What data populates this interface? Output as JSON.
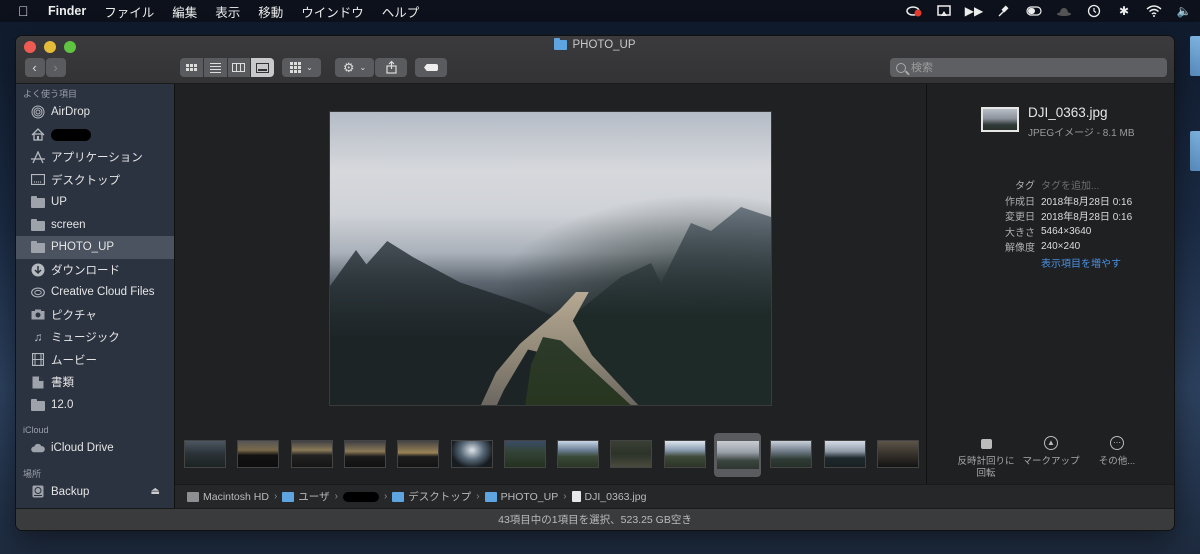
{
  "menubar": {
    "app_name": "Finder",
    "items": [
      "ファイル",
      "編集",
      "表示",
      "移動",
      "ウインドウ",
      "ヘルプ"
    ],
    "tray_icons": [
      "creative-cloud-icon",
      "airplay-icon",
      "fast-forward-icon",
      "pin-icon",
      "toggle-icon",
      "hat-icon",
      "time-machine-icon",
      "bluetooth-icon",
      "wifi-icon",
      "volume-icon"
    ]
  },
  "window": {
    "title": "PHOTO_UP"
  },
  "toolbar": {
    "back_label": "‹",
    "forward_label": "›",
    "view_modes": [
      "icon",
      "list",
      "column",
      "gallery"
    ],
    "active_view": "gallery",
    "search_placeholder": "検索"
  },
  "sidebar": {
    "sections": [
      {
        "header": "よく使う項目",
        "items": [
          {
            "label": "AirDrop",
            "icon": "airdrop-icon"
          },
          {
            "label": "",
            "icon": "home-icon",
            "redacted": true
          },
          {
            "label": "アプリケーション",
            "icon": "applications-icon"
          },
          {
            "label": "デスクトップ",
            "icon": "desktop-icon"
          },
          {
            "label": "UP",
            "icon": "folder-icon"
          },
          {
            "label": "screen",
            "icon": "folder-icon"
          },
          {
            "label": "PHOTO_UP",
            "icon": "folder-icon",
            "selected": true
          },
          {
            "label": "ダウンロード",
            "icon": "download-icon"
          },
          {
            "label": "Creative Cloud Files",
            "icon": "creative-cloud-icon"
          },
          {
            "label": "ピクチャ",
            "icon": "camera-icon"
          },
          {
            "label": "ミュージック",
            "icon": "music-icon"
          },
          {
            "label": "ムービー",
            "icon": "film-icon"
          },
          {
            "label": "書類",
            "icon": "documents-icon"
          },
          {
            "label": "12.0",
            "icon": "folder-icon"
          }
        ]
      },
      {
        "header": "iCloud",
        "items": [
          {
            "label": "iCloud Drive",
            "icon": "cloud-icon"
          }
        ]
      },
      {
        "header": "場所",
        "items": [
          {
            "label": "Backup",
            "icon": "time-machine-disk-icon",
            "eject": true
          }
        ]
      }
    ]
  },
  "gallery": {
    "thumbnail_count": 14,
    "selected_index": 10
  },
  "inspector": {
    "filename": "DJI_0363.jpg",
    "kind": "JPEGイメージ - 8.1 MB",
    "metadata": [
      {
        "key": "タグ",
        "value": "タグを追加...",
        "style": "placeholder"
      },
      {
        "key": "作成日",
        "value": "2018年8月28日 0:16"
      },
      {
        "key": "変更日",
        "value": "2018年8月28日 0:16"
      },
      {
        "key": "大きさ",
        "value": "5464×3640"
      },
      {
        "key": "解像度",
        "value": "240×240"
      },
      {
        "key": "",
        "value": "表示項目を増やす",
        "style": "link"
      }
    ],
    "actions": [
      {
        "label": "反時計回りに回転",
        "icon": "rotate-left-icon"
      },
      {
        "label": "マークアップ",
        "icon": "markup-icon"
      },
      {
        "label": "その他...",
        "icon": "more-icon"
      }
    ]
  },
  "pathbar": {
    "segments": [
      {
        "label": "Macintosh HD",
        "icon": "hard-drive-icon"
      },
      {
        "label": "ユーザ",
        "icon": "folder-icon"
      },
      {
        "label": "",
        "icon": "user-home-icon",
        "redacted": true
      },
      {
        "label": "デスクトップ",
        "icon": "folder-icon"
      },
      {
        "label": "PHOTO_UP",
        "icon": "folder-icon"
      },
      {
        "label": "DJI_0363.jpg",
        "icon": "document-icon"
      }
    ]
  },
  "statusbar": {
    "text": "43項目中の1項目を選択、523.25 GB空き"
  }
}
